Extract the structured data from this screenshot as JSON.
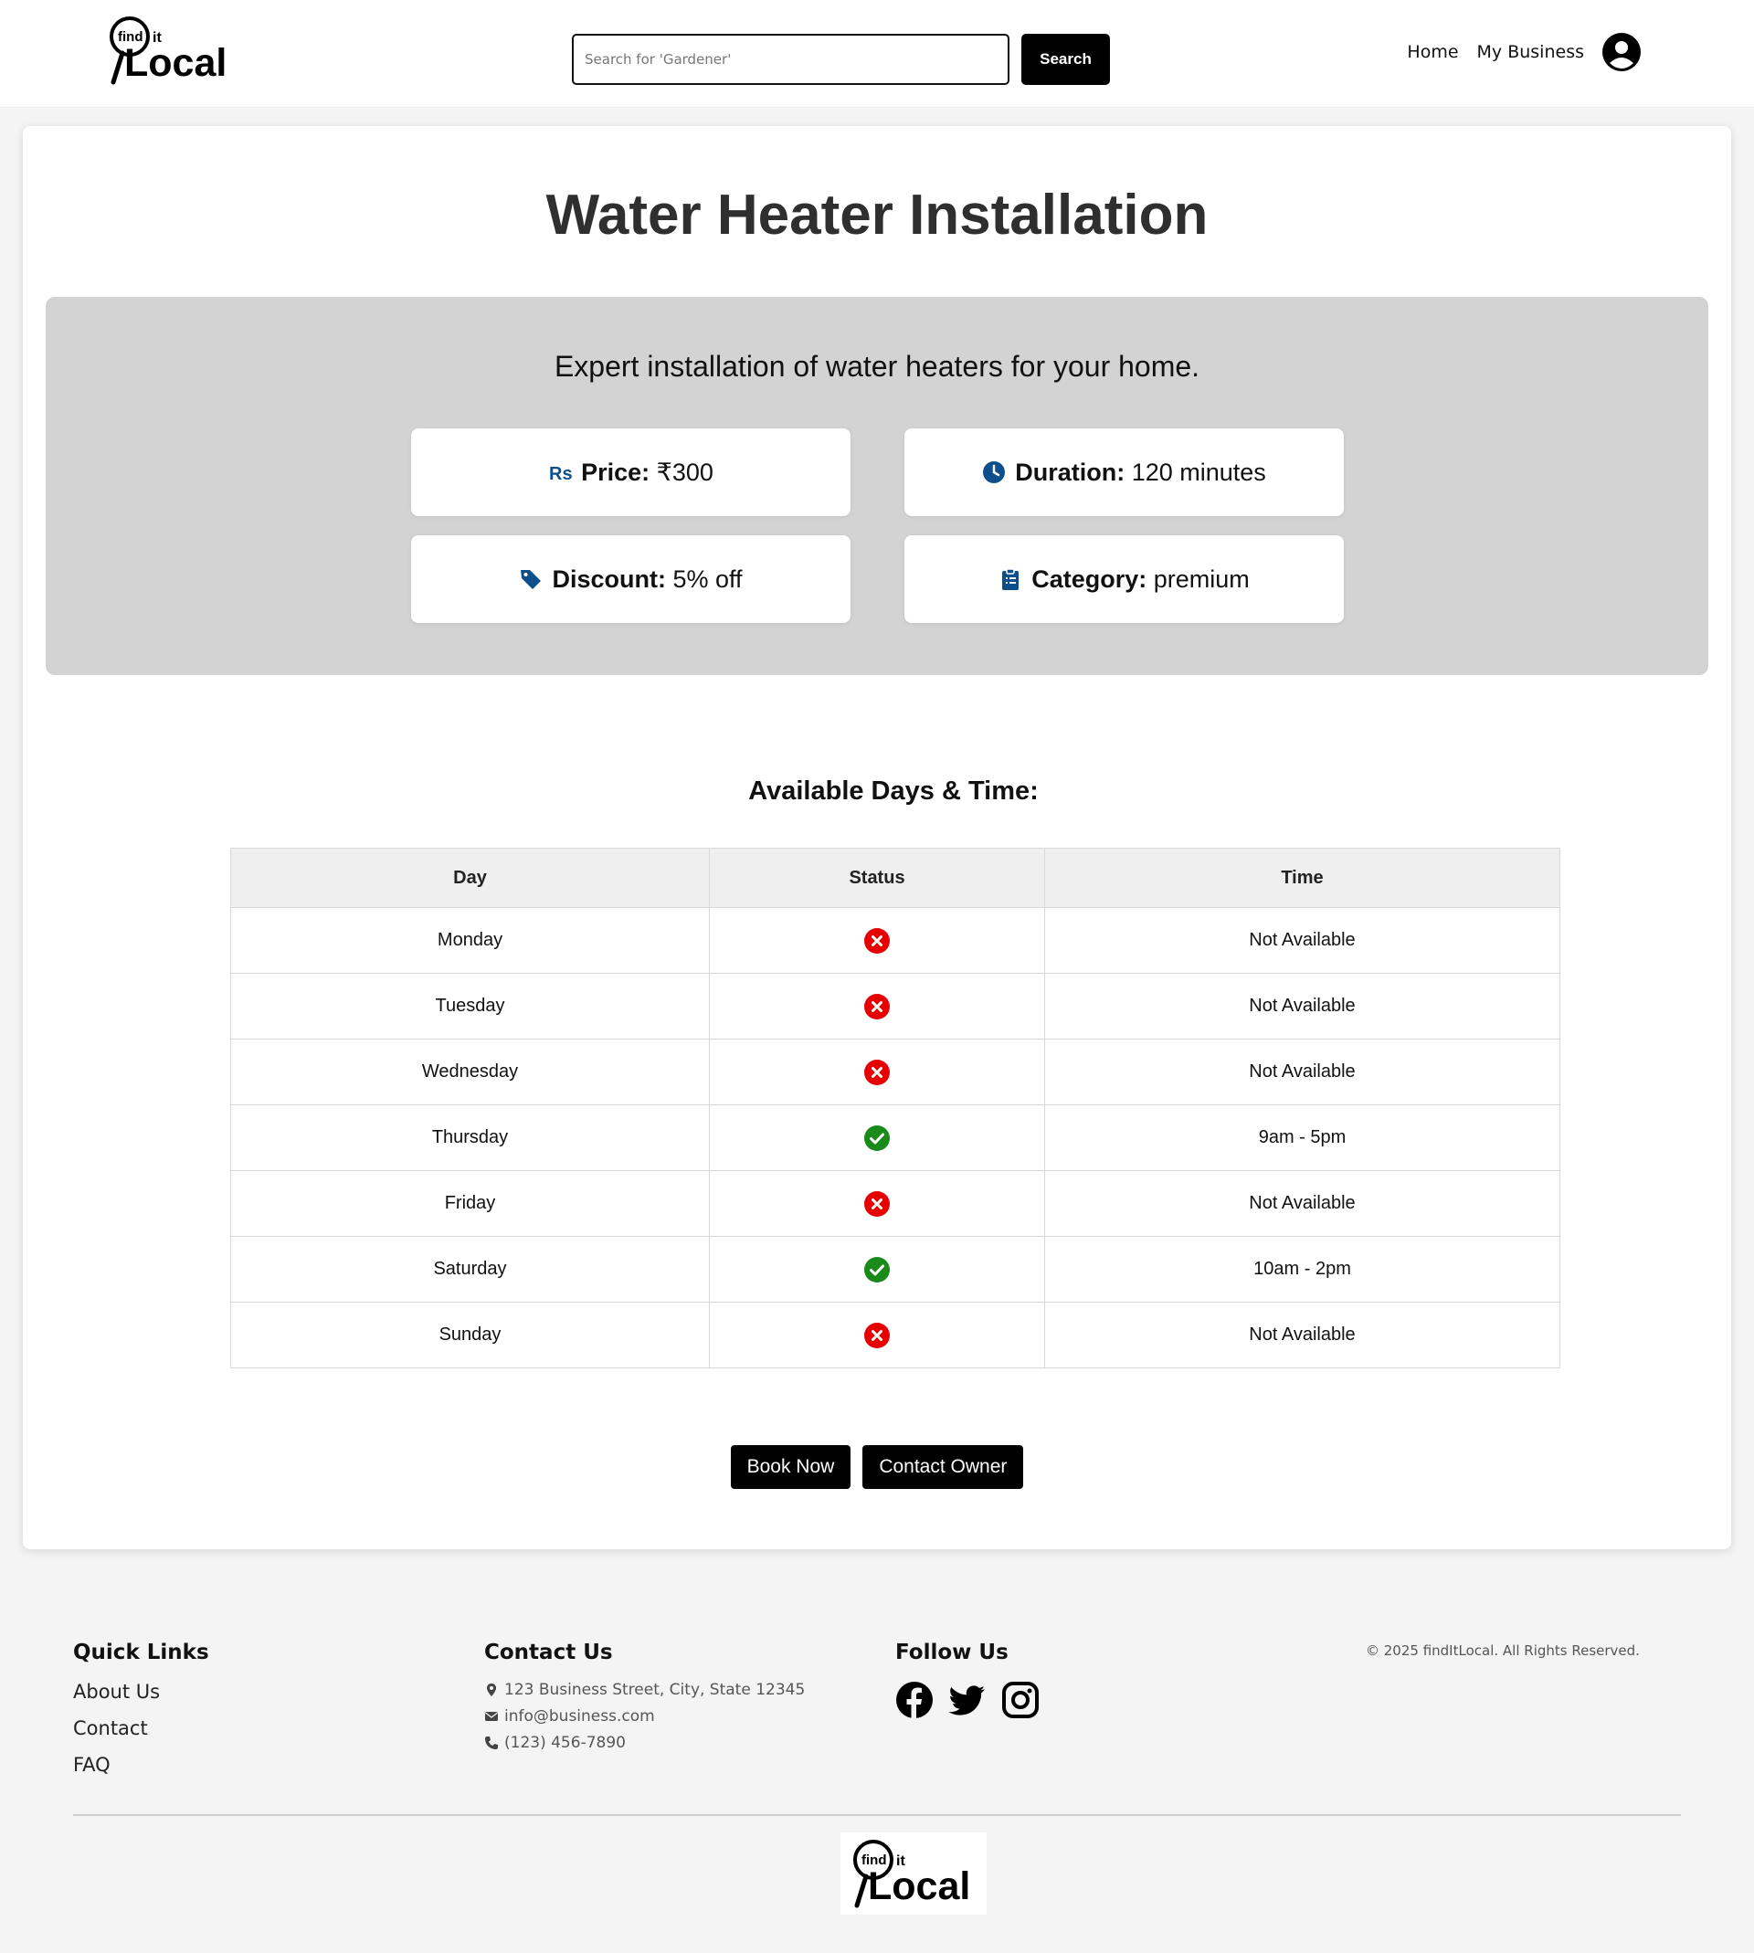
{
  "header": {
    "logo_find": "find",
    "logo_it": "it",
    "logo_local": "Local",
    "search_placeholder": "Search for 'Gardener'",
    "search_label": "Search",
    "nav_home": "Home",
    "nav_business": "My Business",
    "avatar_icon": "user-circle-icon"
  },
  "service": {
    "title": "Water Heater Installation",
    "description": "Expert installation of water heaters for your home.",
    "price_label": "Price:",
    "price_value": "₹300",
    "duration_label": "Duration:",
    "duration_value": "120 minutes",
    "discount_label": "Discount:",
    "discount_value": "5% off",
    "category_label": "Category:",
    "category_value": "premium",
    "accent_color": "#0d4f8b"
  },
  "availability": {
    "heading": "Available Days & Time:",
    "columns": [
      "Day",
      "Status",
      "Time"
    ],
    "rows": [
      {
        "day": "Monday",
        "available": false,
        "time": "Not Available"
      },
      {
        "day": "Tuesday",
        "available": false,
        "time": "Not Available"
      },
      {
        "day": "Wednesday",
        "available": false,
        "time": "Not Available"
      },
      {
        "day": "Thursday",
        "available": true,
        "time": "9am - 5pm"
      },
      {
        "day": "Friday",
        "available": false,
        "time": "Not Available"
      },
      {
        "day": "Saturday",
        "available": true,
        "time": "10am - 2pm"
      },
      {
        "day": "Sunday",
        "available": false,
        "time": "Not Available"
      }
    ],
    "available_color": "#1a8a1a",
    "unavailable_color": "#e60000"
  },
  "actions": {
    "book_label": "Book Now",
    "contact_label": "Contact Owner"
  },
  "footer": {
    "quick_links_title": "Quick Links",
    "links": [
      "About Us",
      "Contact",
      "FAQ"
    ],
    "contact_title": "Contact Us",
    "address": "123 Business Street, City, State 12345",
    "email": "info@business.com",
    "phone": "(123) 456-7890",
    "follow_title": "Follow Us",
    "social_icons": [
      "facebook-icon",
      "twitter-icon",
      "instagram-icon"
    ],
    "copyright": "© 2025 findItLocal. All Rights Reserved."
  }
}
